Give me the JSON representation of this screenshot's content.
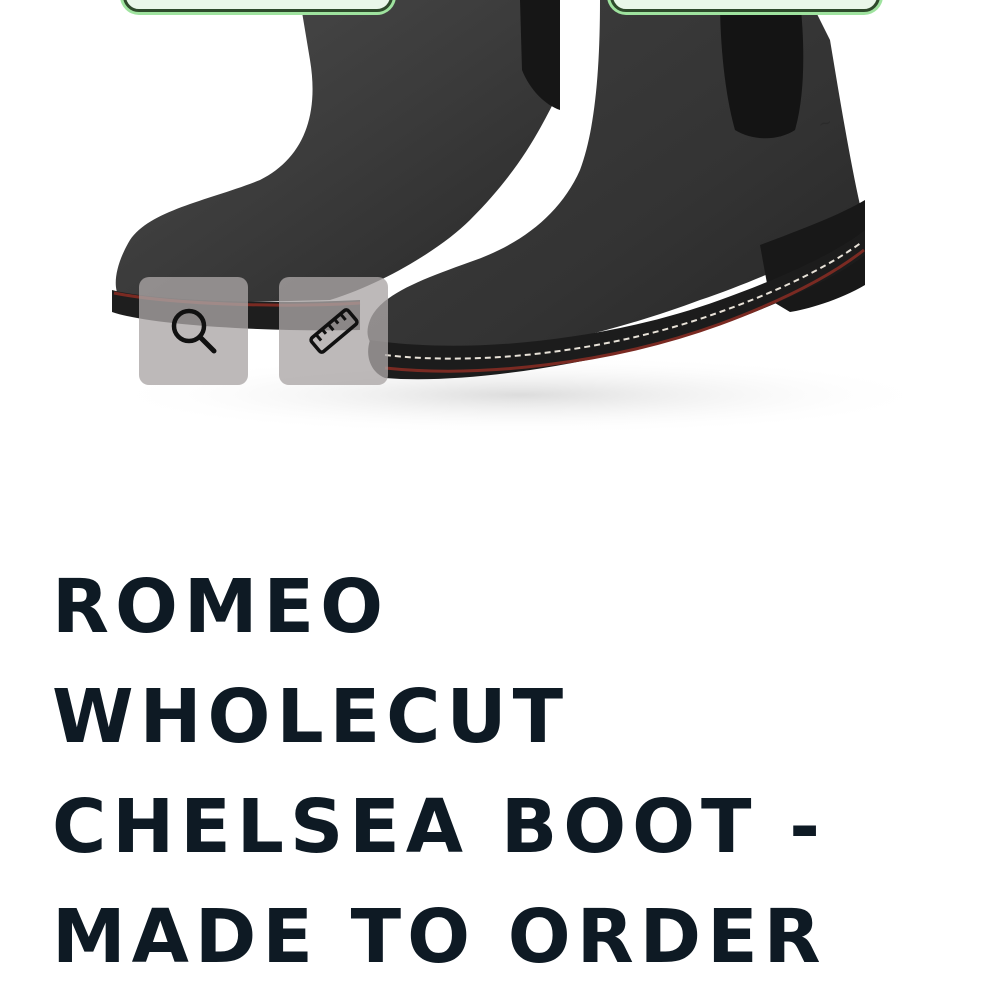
{
  "product": {
    "title": "ROMEO\nWHOLECUT\nCHELSEA BOOT -\nMADE TO ORDER"
  },
  "gallery": {
    "image_subject": "boot-photo",
    "buttons": [
      {
        "icon": "magnifier-icon"
      },
      {
        "icon": "ruler-icon"
      }
    ]
  },
  "colors": {
    "title": "#0e1a24",
    "button_bg": "#aaa5a5",
    "badge_border": "#2e4a2b",
    "badge_glow": "#9fe39f",
    "leather": "#3a3a3a",
    "sole": "#1c1c1c",
    "welt_stitch": "#7a2a22"
  }
}
